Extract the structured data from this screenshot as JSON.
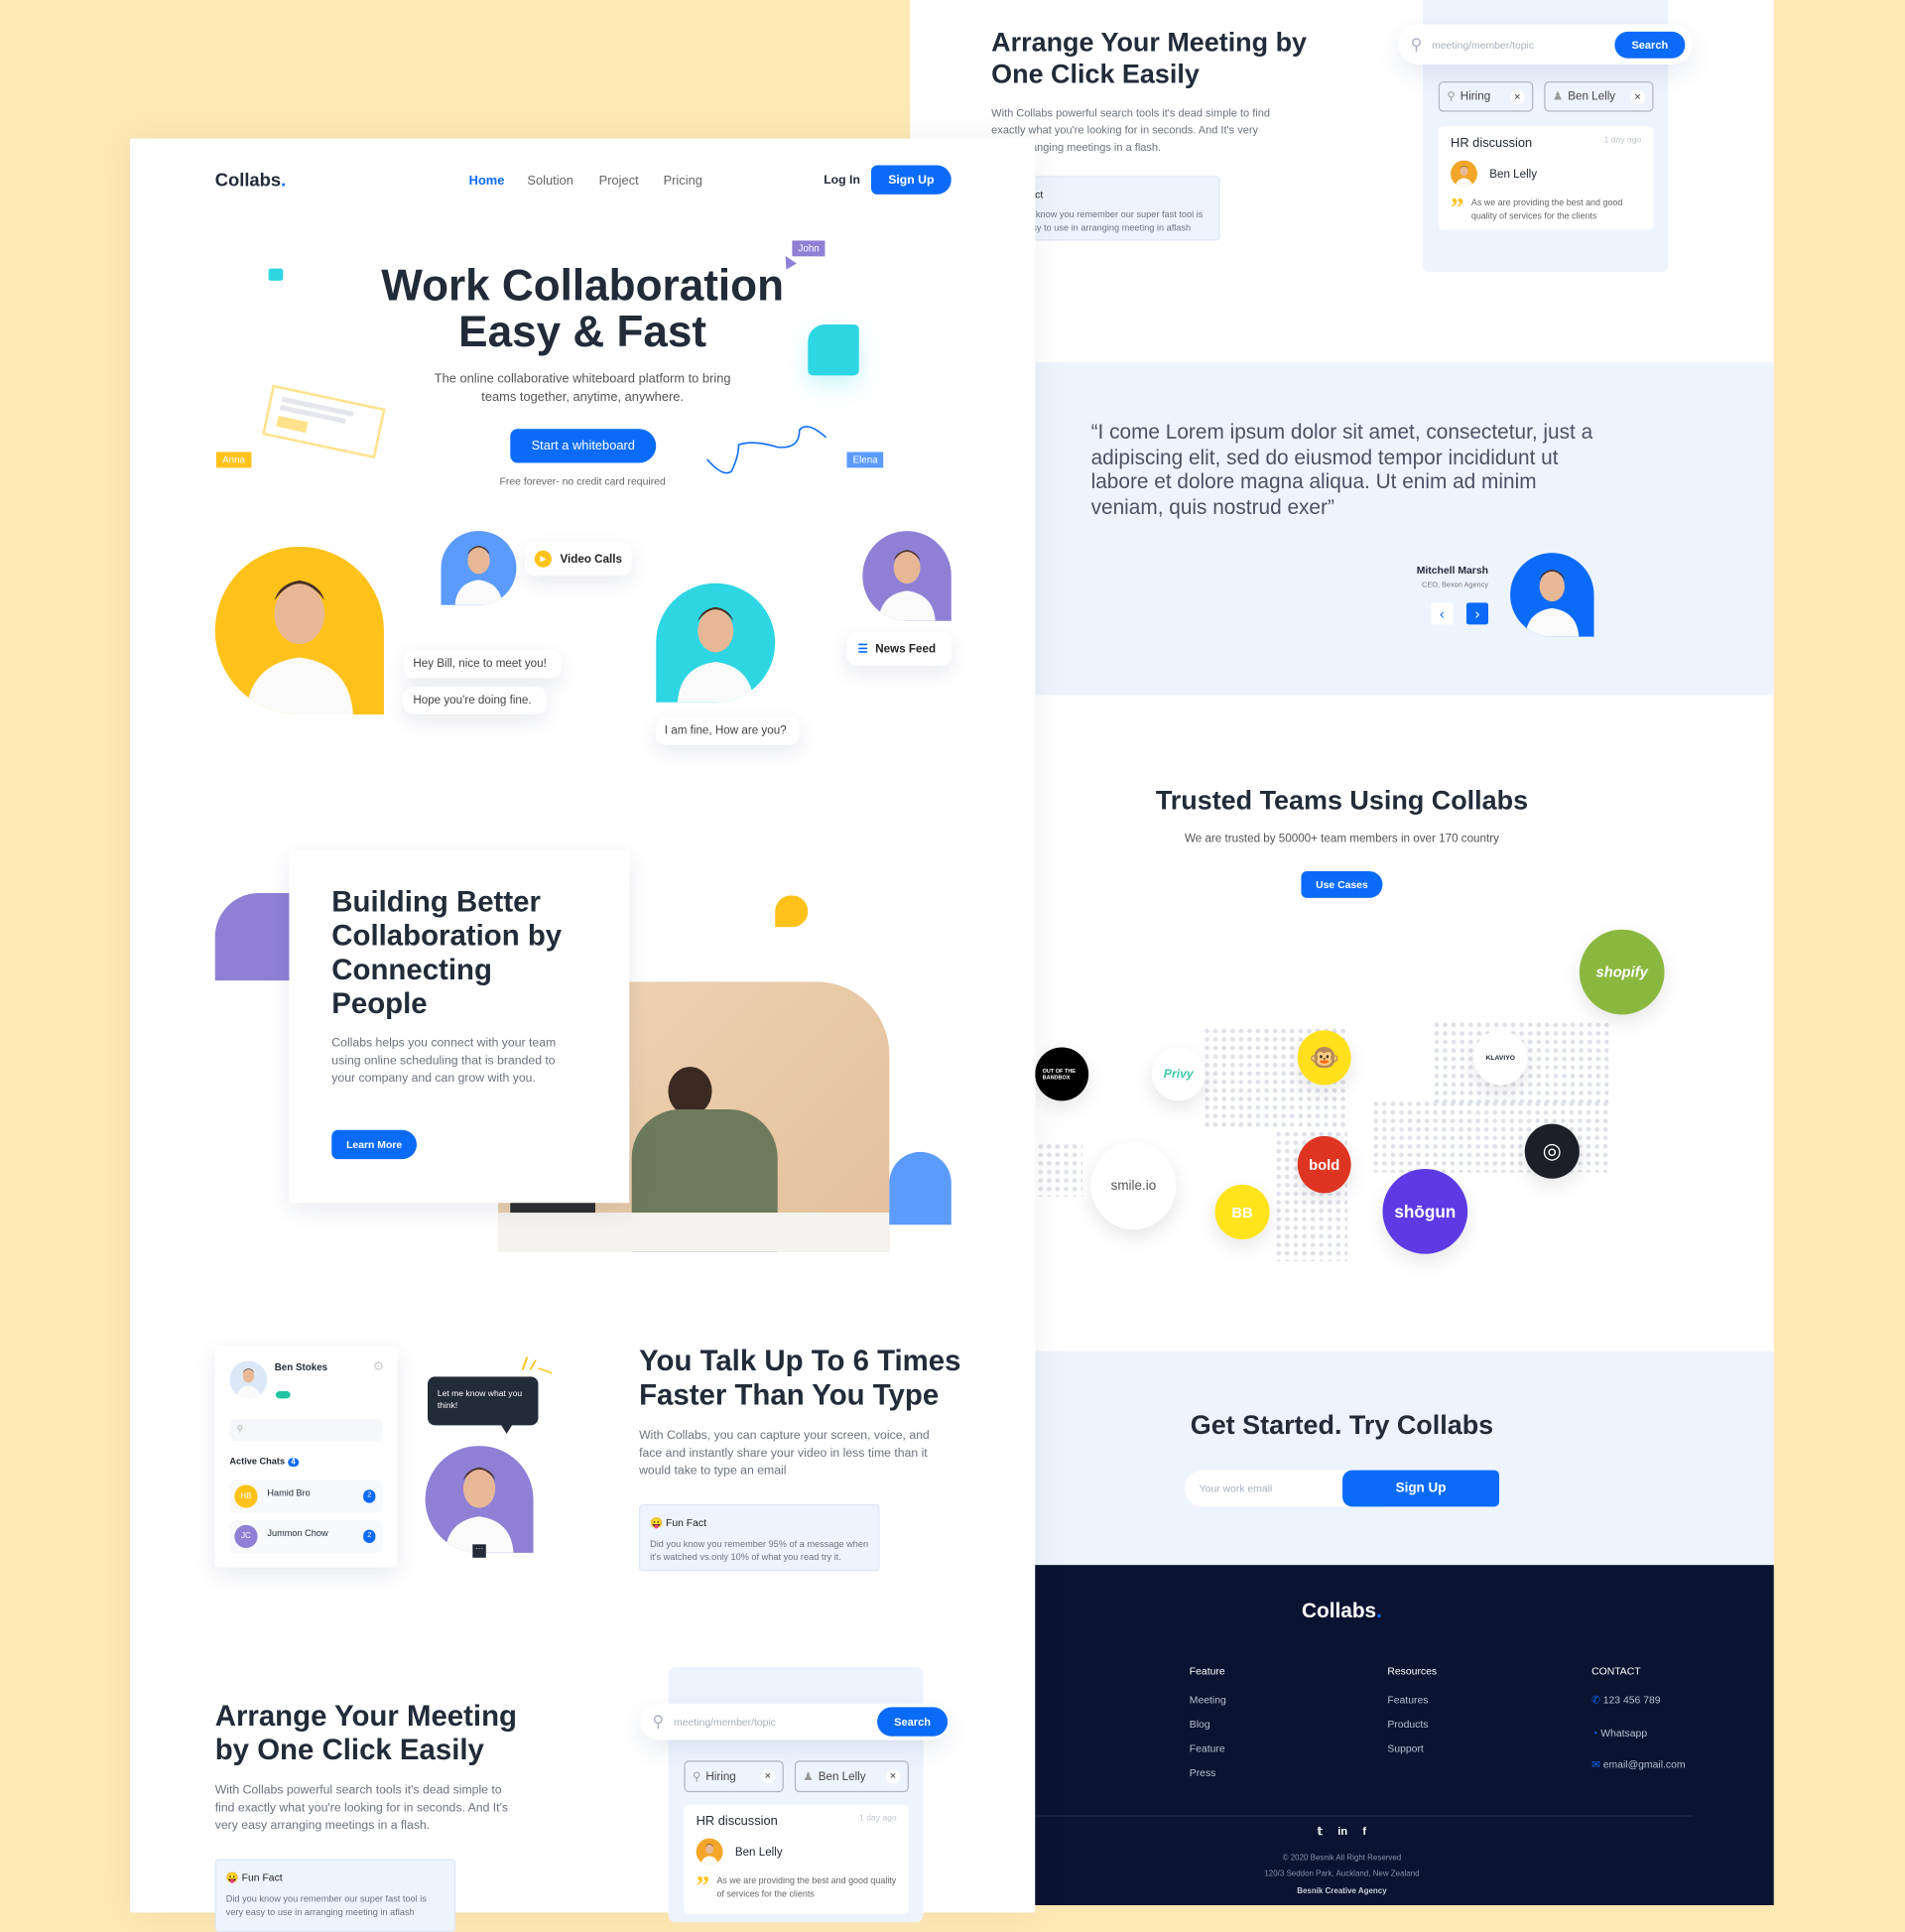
{
  "colors": {
    "accent": "#0B6BF9",
    "background": "#FEE8B4",
    "footer": "#0A1330",
    "yellow": "#FFC21A",
    "cyan": "#2ED6E3",
    "purple": "#8F80D6"
  },
  "nav": {
    "logo": "Collabs",
    "logo_dot": ".",
    "items": [
      "Home",
      "Solution",
      "Project",
      "Pricing"
    ],
    "active": "Home",
    "login": "Log In",
    "signup": "Sign Up"
  },
  "hero": {
    "title_line1": "Work Collaboration",
    "title_line2": "Easy & Fast",
    "subtitle_line1": "The online collaborative whiteboard platform to bring",
    "subtitle_line2": "teams together, anytime, anywhere.",
    "cta": "Start a whiteboard",
    "note": "Free forever- no credit card required",
    "cursors": [
      "John",
      "Anna",
      "Elena"
    ],
    "video_calls": "Video Calls",
    "news_feed": "News Feed",
    "bubbles": [
      "Hey Bill, nice to meet you!",
      "Hope you're doing fine.",
      "I am fine, How are you?"
    ]
  },
  "building": {
    "title": "Building Better Collaboration by Connecting People",
    "text": "Collabs helps you connect with your team using online scheduling that is branded to your company and can grow with you.",
    "cta": "Learn More"
  },
  "talk": {
    "chat_name": "Ben Stokes",
    "active_chats": "Active Chats",
    "active_count": "4",
    "chats": [
      {
        "initials": "HB",
        "name": "Hamid Bro",
        "count": "2"
      },
      {
        "initials": "JC",
        "name": "Jummon Chow",
        "count": "2"
      }
    ],
    "bubble": "Let me know what you think!",
    "title": "You Talk Up To 6 Times Faster Than You Type",
    "text": "With Collabs, you can capture your screen, voice, and face and instantly share your video in less time than it would take to type an email",
    "fact_title": "Fun Fact",
    "fact_text": "Did you know you remember 95% of a message when it's watched vs.only 10% of what you read try it."
  },
  "arrange": {
    "title": "Arrange Your Meeting by One Click Easily",
    "text": "With Collabs powerful search tools it's dead simple to find exactly what you're looking for in seconds. And It's very easy arranging meetings in a flash.",
    "fact_title": "Fun Fact",
    "fact_text": "Did you know you remember our super fast tool is very easy to use in arranging meeting in aflash",
    "search_placeholder": "meeting/member/topic",
    "search_button": "Search",
    "chips": [
      "Hiring",
      "Ben Lelly"
    ],
    "card_title": "HR discussion",
    "card_time": "1 day ago",
    "card_user": "Ben Lelly",
    "card_quote": "As we are providing the best and good quality of services for the clients"
  },
  "testimonial": {
    "quote": "“I come Lorem ipsum dolor sit amet, consectetur, just a adipiscing elit, sed do eiusmod tempor incididunt ut labore et dolore magna aliqua. Ut enim ad minim veniam, quis nostrud exer”",
    "name": "Mitchell Marsh",
    "role": "CEO, Bexon Agency"
  },
  "trusted": {
    "title": "Trusted Teams Using Collabs",
    "subtitle": "We are trusted by 50000+ team members in over 170 country",
    "cta": "Use Cases",
    "logos": [
      "shopify",
      "OUT OF THE BANDBOX",
      "Privy",
      "KLAVIYO",
      "smile.io",
      "bold",
      "BB",
      "shōgun"
    ]
  },
  "get_started": {
    "title": "Get Started. Try Collabs",
    "email_placeholder": "Your work email",
    "cta": "Sign Up"
  },
  "footer": {
    "logo": "Collabs",
    "feature_title": "Feature",
    "feature_items": [
      "Meeting",
      "Blog",
      "Feature",
      "Press"
    ],
    "resources_title": "Resources",
    "resources_items": [
      "Features",
      "Products",
      "Support"
    ],
    "contact_title": "CONTACT",
    "phone": "123 456 789",
    "whatsapp": "Whatsapp",
    "email": "email@gmail.com",
    "copyright": "©  2020 Besnik All Right Reserved",
    "address": "120/3 Seddon Park, Auckland, New Zealand",
    "agency": "Besnik Creative Agency"
  }
}
